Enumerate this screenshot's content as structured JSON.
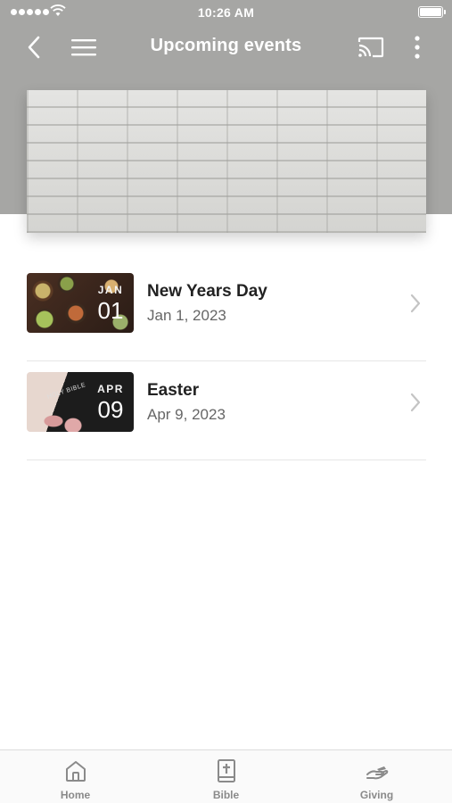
{
  "status_bar": {
    "time": "10:26 AM"
  },
  "nav": {
    "title": "Upcoming events",
    "icons": [
      "back-icon",
      "menu-icon",
      "cast-icon",
      "more-vertical-icon"
    ]
  },
  "events": [
    {
      "name": "New Years Day",
      "date": "Jan 1, 2023",
      "month": "JAN",
      "day": "01",
      "thumb_label": ""
    },
    {
      "name": "Easter",
      "date": "Apr 9, 2023",
      "month": "APR",
      "day": "09",
      "thumb_label": "HOLY BIBLE"
    }
  ],
  "tabs": [
    {
      "label": "Home",
      "icon": "home-icon"
    },
    {
      "label": "Bible",
      "icon": "bible-icon"
    },
    {
      "label": "Giving",
      "icon": "giving-icon"
    }
  ],
  "colors": {
    "header": "#a6a6a4",
    "text_primary": "#222222",
    "text_secondary": "#666666",
    "tab_label": "#8a8a8a"
  }
}
